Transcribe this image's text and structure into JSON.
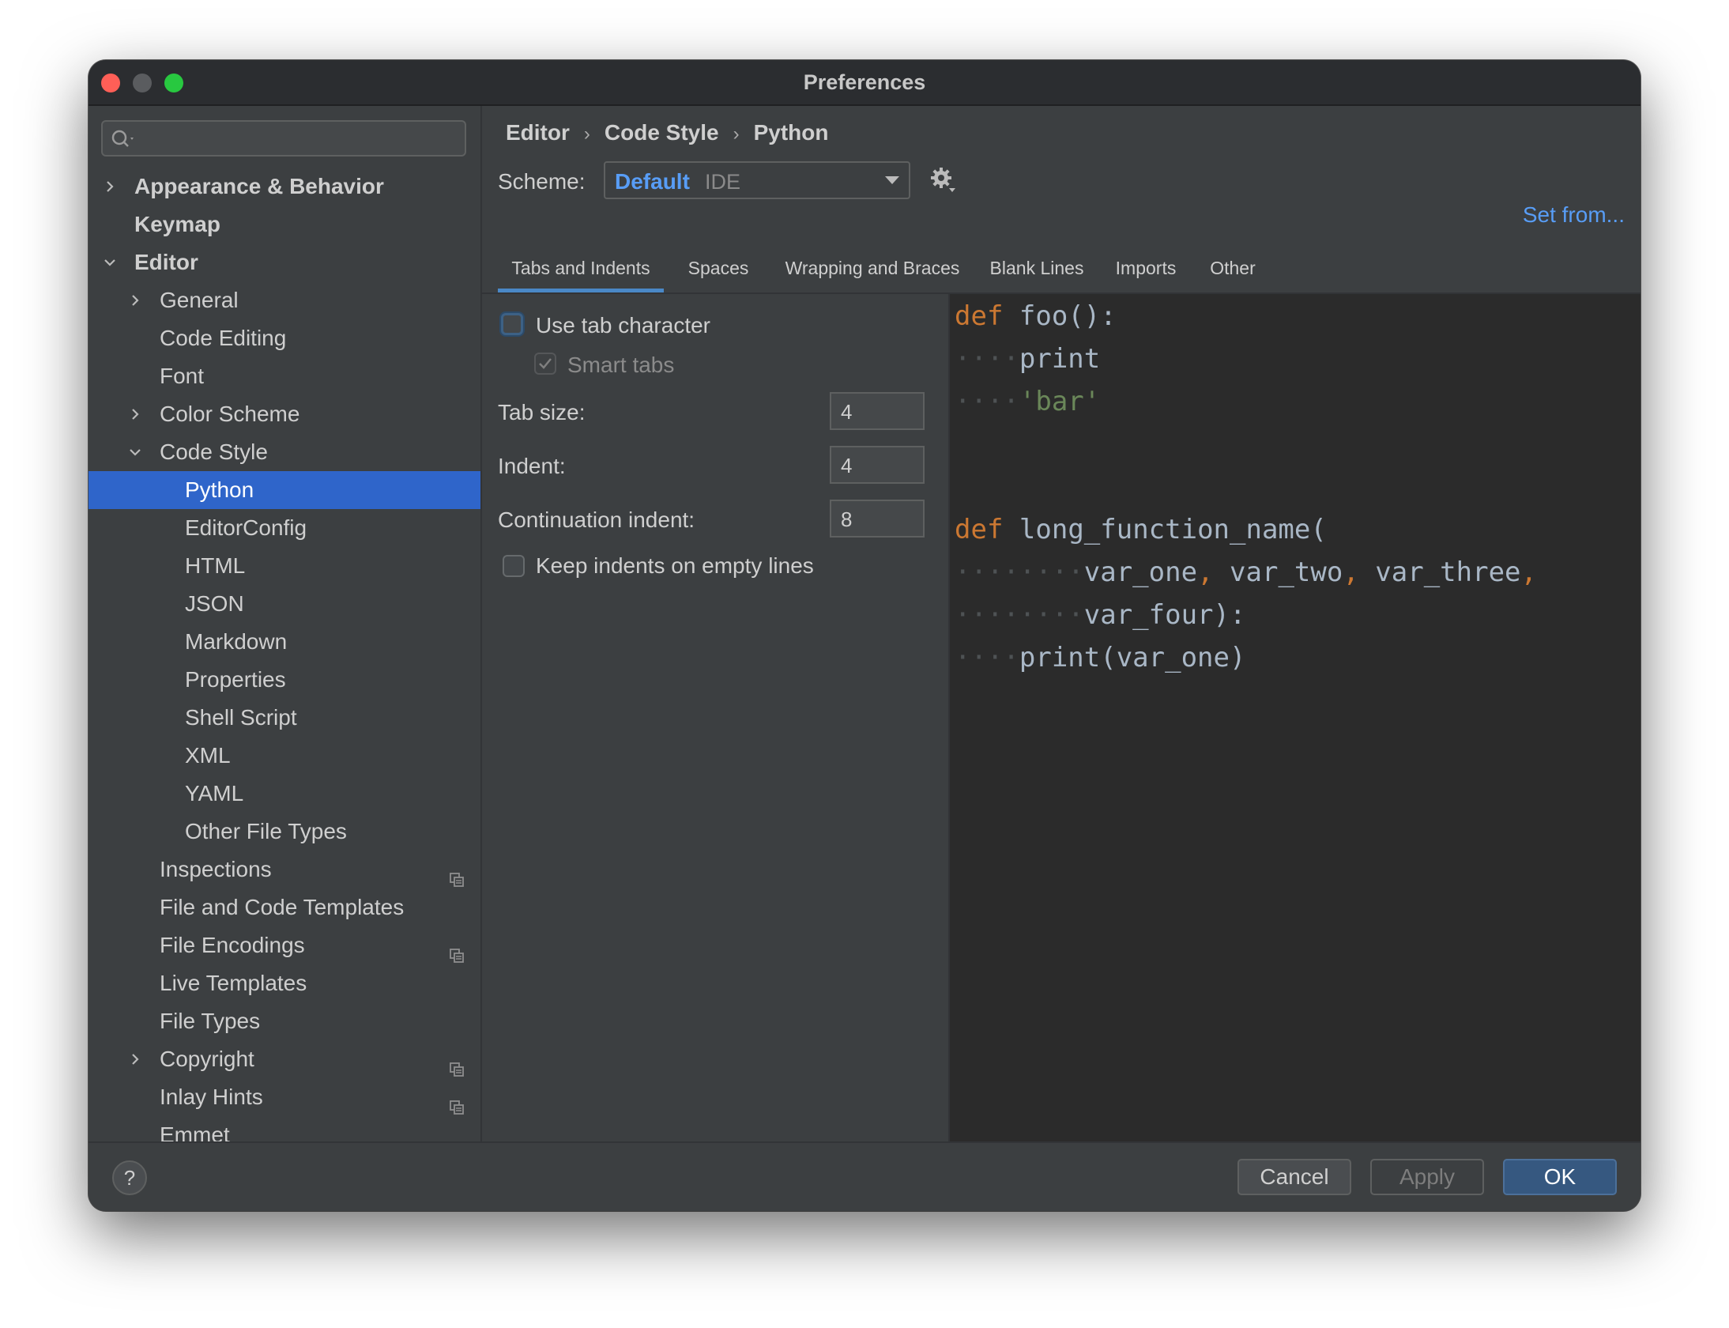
{
  "window": {
    "title": "Preferences"
  },
  "search": {
    "placeholder": ""
  },
  "sidebar": {
    "items": [
      {
        "label": "Appearance & Behavior",
        "level": 0,
        "arrow": "right",
        "bold": true
      },
      {
        "label": "Keymap",
        "level": 0,
        "arrow": "none",
        "bold": true
      },
      {
        "label": "Editor",
        "level": 0,
        "arrow": "down",
        "bold": true
      },
      {
        "label": "General",
        "level": 1,
        "arrow": "right"
      },
      {
        "label": "Code Editing",
        "level": 1,
        "arrow": "none"
      },
      {
        "label": "Font",
        "level": 1,
        "arrow": "none"
      },
      {
        "label": "Color Scheme",
        "level": 1,
        "arrow": "right"
      },
      {
        "label": "Code Style",
        "level": 1,
        "arrow": "down"
      },
      {
        "label": "Python",
        "level": 2,
        "selected": true
      },
      {
        "label": "EditorConfig",
        "level": 2
      },
      {
        "label": "HTML",
        "level": 2
      },
      {
        "label": "JSON",
        "level": 2
      },
      {
        "label": "Markdown",
        "level": 2
      },
      {
        "label": "Properties",
        "level": 2
      },
      {
        "label": "Shell Script",
        "level": 2
      },
      {
        "label": "XML",
        "level": 2
      },
      {
        "label": "YAML",
        "level": 2
      },
      {
        "label": "Other File Types",
        "level": 2
      },
      {
        "label": "Inspections",
        "level": 1,
        "arrow": "none",
        "project_icon": true
      },
      {
        "label": "File and Code Templates",
        "level": 1,
        "arrow": "none"
      },
      {
        "label": "File Encodings",
        "level": 1,
        "arrow": "none",
        "project_icon": true
      },
      {
        "label": "Live Templates",
        "level": 1,
        "arrow": "none"
      },
      {
        "label": "File Types",
        "level": 1,
        "arrow": "none"
      },
      {
        "label": "Copyright",
        "level": 1,
        "arrow": "right",
        "project_icon": true
      },
      {
        "label": "Inlay Hints",
        "level": 1,
        "arrow": "none",
        "project_icon": true
      },
      {
        "label": "Emmet",
        "level": 1,
        "arrow": "none"
      }
    ]
  },
  "breadcrumb": {
    "part1": "Editor",
    "part2": "Code Style",
    "part3": "Python",
    "separator": "›"
  },
  "scheme": {
    "label": "Scheme:",
    "name": "Default",
    "sub": "IDE",
    "set_from": "Set from..."
  },
  "tabs": [
    "Tabs and Indents",
    "Spaces",
    "Wrapping and Braces",
    "Blank Lines",
    "Imports",
    "Other"
  ],
  "active_tab": "Tabs and Indents",
  "options": {
    "use_tab_character": {
      "label": "Use tab character",
      "checked": false
    },
    "smart_tabs": {
      "label": "Smart tabs",
      "checked": true,
      "disabled": true
    },
    "tab_size": {
      "label": "Tab size:",
      "value": "4"
    },
    "indent": {
      "label": "Indent:",
      "value": "4"
    },
    "continuation_indent": {
      "label": "Continuation indent:",
      "value": "8"
    },
    "keep_indents": {
      "label": "Keep indents on empty lines",
      "checked": false
    }
  },
  "preview": {
    "line1_kw": "def",
    "line1_rest": "foo():",
    "line2_dots": "····",
    "line2_code": "print",
    "line3_dots": "····",
    "line3_str": "'bar'",
    "line4_kw": "def",
    "line4_rest": "long_function_name(",
    "line5_dots": "········",
    "line5_a": "var_one",
    "line5_b": "var_two",
    "line5_c": "var_three",
    "comma": ",",
    "line6_dots": "········",
    "line6_code": "var_four):",
    "line7_dots": "····",
    "line7_code": "print(var_one)"
  },
  "footer": {
    "help": "?",
    "cancel": "Cancel",
    "apply": "Apply",
    "ok": "OK"
  },
  "colors": {
    "accent": "#2f65ca",
    "link": "#589df6",
    "keyword": "#cc7832",
    "string": "#6a8759"
  }
}
